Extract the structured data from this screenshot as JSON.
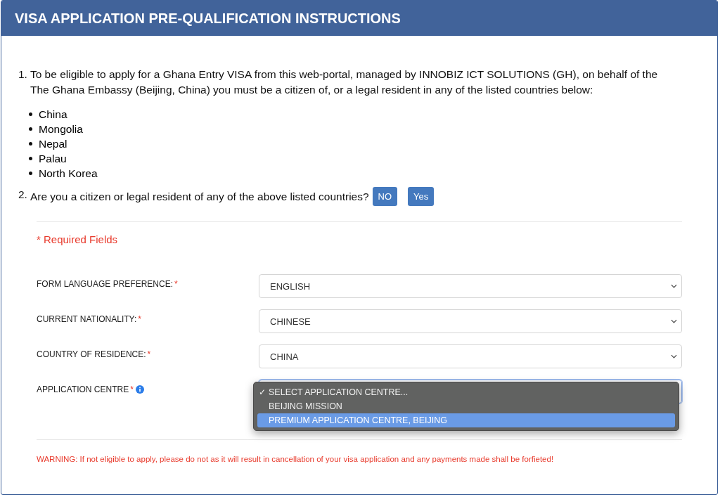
{
  "header": {
    "title": "VISA APPLICATION PRE-QUALIFICATION INSTRUCTIONS"
  },
  "instructions": [
    {
      "number": "1.",
      "text": "To be eligible to apply for a Ghana Entry VISA from this web-portal, managed by INNOBIZ ICT SOLUTIONS (GH), on behalf of the The Ghana Embassy (Beijing, China) you must be a citizen of, or a legal resident in any of the listed countries below:",
      "countries": [
        "China",
        "Mongolia",
        "Nepal",
        "Palau",
        "North Korea"
      ]
    },
    {
      "number": "2.",
      "text": "Are you a citizen or legal resident of any of the above listed countries?",
      "buttons": [
        "NO",
        "Yes"
      ]
    }
  ],
  "required_note": "* Required Fields",
  "fields": [
    {
      "label": "FORM LANGUAGE PREFERENCE:",
      "mark": "*",
      "info": false,
      "value": "ENGLISH",
      "open": false
    },
    {
      "label": "CURRENT NATIONALITY:",
      "mark": "*",
      "info": false,
      "value": "CHINESE",
      "open": false
    },
    {
      "label": "COUNTRY OF RESIDENCE:",
      "mark": "*",
      "info": false,
      "value": "CHINA",
      "open": false
    },
    {
      "label": "APPLICATION CENTRE",
      "mark": "*",
      "info": true,
      "open": true,
      "options": [
        {
          "text": "SELECT APPLICATION CENTRE...",
          "checked": true,
          "highlighted": false
        },
        {
          "text": "BEIJING MISSION",
          "checked": false,
          "highlighted": false
        },
        {
          "text": "PREMIUM APPLICATION CENTRE, BEIJING",
          "checked": false,
          "highlighted": true
        }
      ]
    }
  ],
  "check_glyph": "✓",
  "warning": "WARNING: If not eligible to apply, please do not as it will result in cancellation of your visa application and any payments made shall be forfieted!"
}
